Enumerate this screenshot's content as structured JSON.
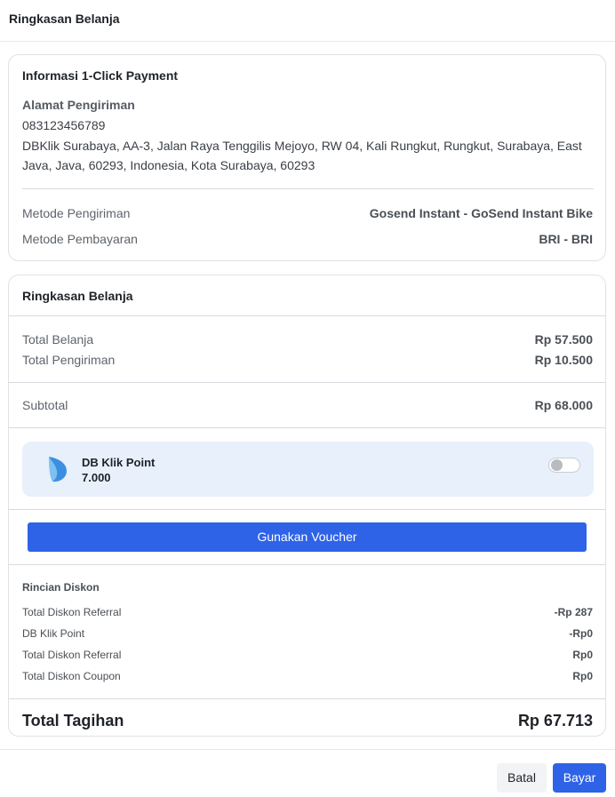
{
  "header": {
    "title": "Ringkasan Belanja"
  },
  "payment_info": {
    "title": "Informasi 1-Click Payment",
    "address_label": "Alamat Pengiriman",
    "phone": "083123456789",
    "address_line1": "DBKlik Surabaya, AA-3, Jalan Raya Tenggilis Mejoyo, RW 04, Kali Rungkut, Rungkut, Surabaya, East",
    "address_line2": "Java, Java, 60293, Indonesia, Kota Surabaya, 60293",
    "shipping_method_label": "Metode Pengiriman",
    "shipping_method_value": "Gosend Instant - GoSend Instant Bike",
    "payment_method_label": "Metode Pembayaran",
    "payment_method_value": "BRI - BRI"
  },
  "summary": {
    "title": "Ringkasan Belanja",
    "total_belanja_label": "Total Belanja",
    "total_belanja_value": "Rp 57.500",
    "total_pengiriman_label": "Total Pengiriman",
    "total_pengiriman_value": "Rp 10.500",
    "subtotal_label": "Subtotal",
    "subtotal_value": "Rp 68.000",
    "points": {
      "name": "DB Klik Point",
      "value": "7.000",
      "toggle_on": false
    },
    "voucher_button": "Gunakan Voucher",
    "discount": {
      "title": "Rincian Diskon",
      "rows": [
        {
          "label": "Total Diskon Referral",
          "value": "-Rp 287"
        },
        {
          "label": "DB Klik Point",
          "value": "-Rp0"
        },
        {
          "label": "Total Diskon Referral",
          "value": "Rp0"
        },
        {
          "label": "Total Diskon Coupon",
          "value": "Rp0"
        }
      ]
    },
    "total_label": "Total Tagihan",
    "total_value": "Rp 67.713"
  },
  "footer": {
    "cancel_label": "Batal",
    "pay_label": "Bayar"
  },
  "colors": {
    "primary": "#2e63e8",
    "points_bg": "#e8f0fb",
    "logo": "#3b8fe0"
  }
}
